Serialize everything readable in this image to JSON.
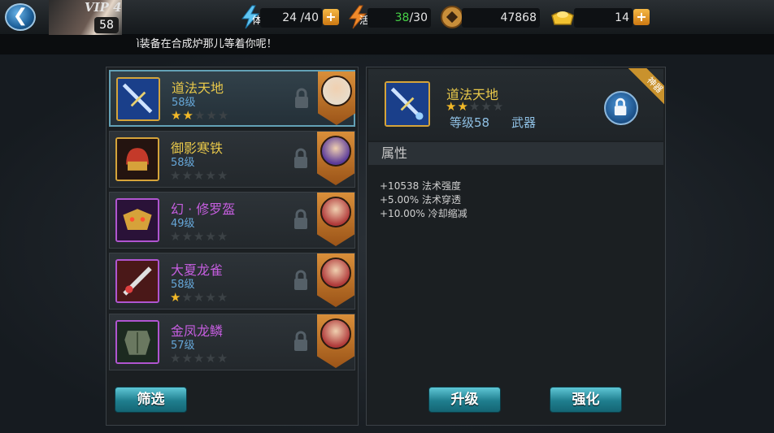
{
  "header": {
    "vip_label": "VIP 4",
    "player_level": "58",
    "stamina": {
      "icon": "lightning-icon",
      "char": "体",
      "value": "24 /40"
    },
    "activity": {
      "icon": "lightning-orange-icon",
      "char": "活",
      "current": "38",
      "max": "/30",
      "current_color": "#46d046"
    },
    "coins": {
      "icon": "coin-icon",
      "value": "47868"
    },
    "gold": {
      "icon": "gold-ingot-icon",
      "value": "14"
    },
    "plus": "+"
  },
  "marquee": {
    "text": "ì装备在合成炉那儿等着你呢！"
  },
  "list": {
    "items": [
      {
        "name": "道法天地",
        "level": "58级",
        "stars": 2,
        "name_color": "#e8c84a",
        "icon_type": "sword",
        "hero": "white-hair"
      },
      {
        "name": "御影寒铁",
        "level": "58级",
        "stars": 0,
        "name_color": "#e8c84a",
        "icon_type": "helmet",
        "hero": "purple-mask"
      },
      {
        "name": "幻 · 修罗盔",
        "level": "49级",
        "stars": 0,
        "name_color": "#c65ee0",
        "icon_type": "mask",
        "hero": "red-girl"
      },
      {
        "name": "大夏龙雀",
        "level": "58级",
        "stars": 1,
        "name_color": "#c65ee0",
        "icon_type": "blade",
        "hero": "red-girl"
      },
      {
        "name": "金凤龙鳞",
        "level": "57级",
        "stars": 0,
        "name_color": "#c65ee0",
        "icon_type": "armor",
        "hero": "red-girl"
      }
    ],
    "filter_label": "筛选"
  },
  "detail": {
    "name": "道法天地",
    "stars": 2,
    "level": "等级58",
    "type": "武器",
    "ribbon": "神器",
    "attr_title": "属性",
    "attributes": [
      "+10538 法术强度",
      "+5.00% 法术穿透",
      "+10.00% 冷却缩减"
    ],
    "upgrade_label": "升级",
    "enhance_label": "强化"
  }
}
